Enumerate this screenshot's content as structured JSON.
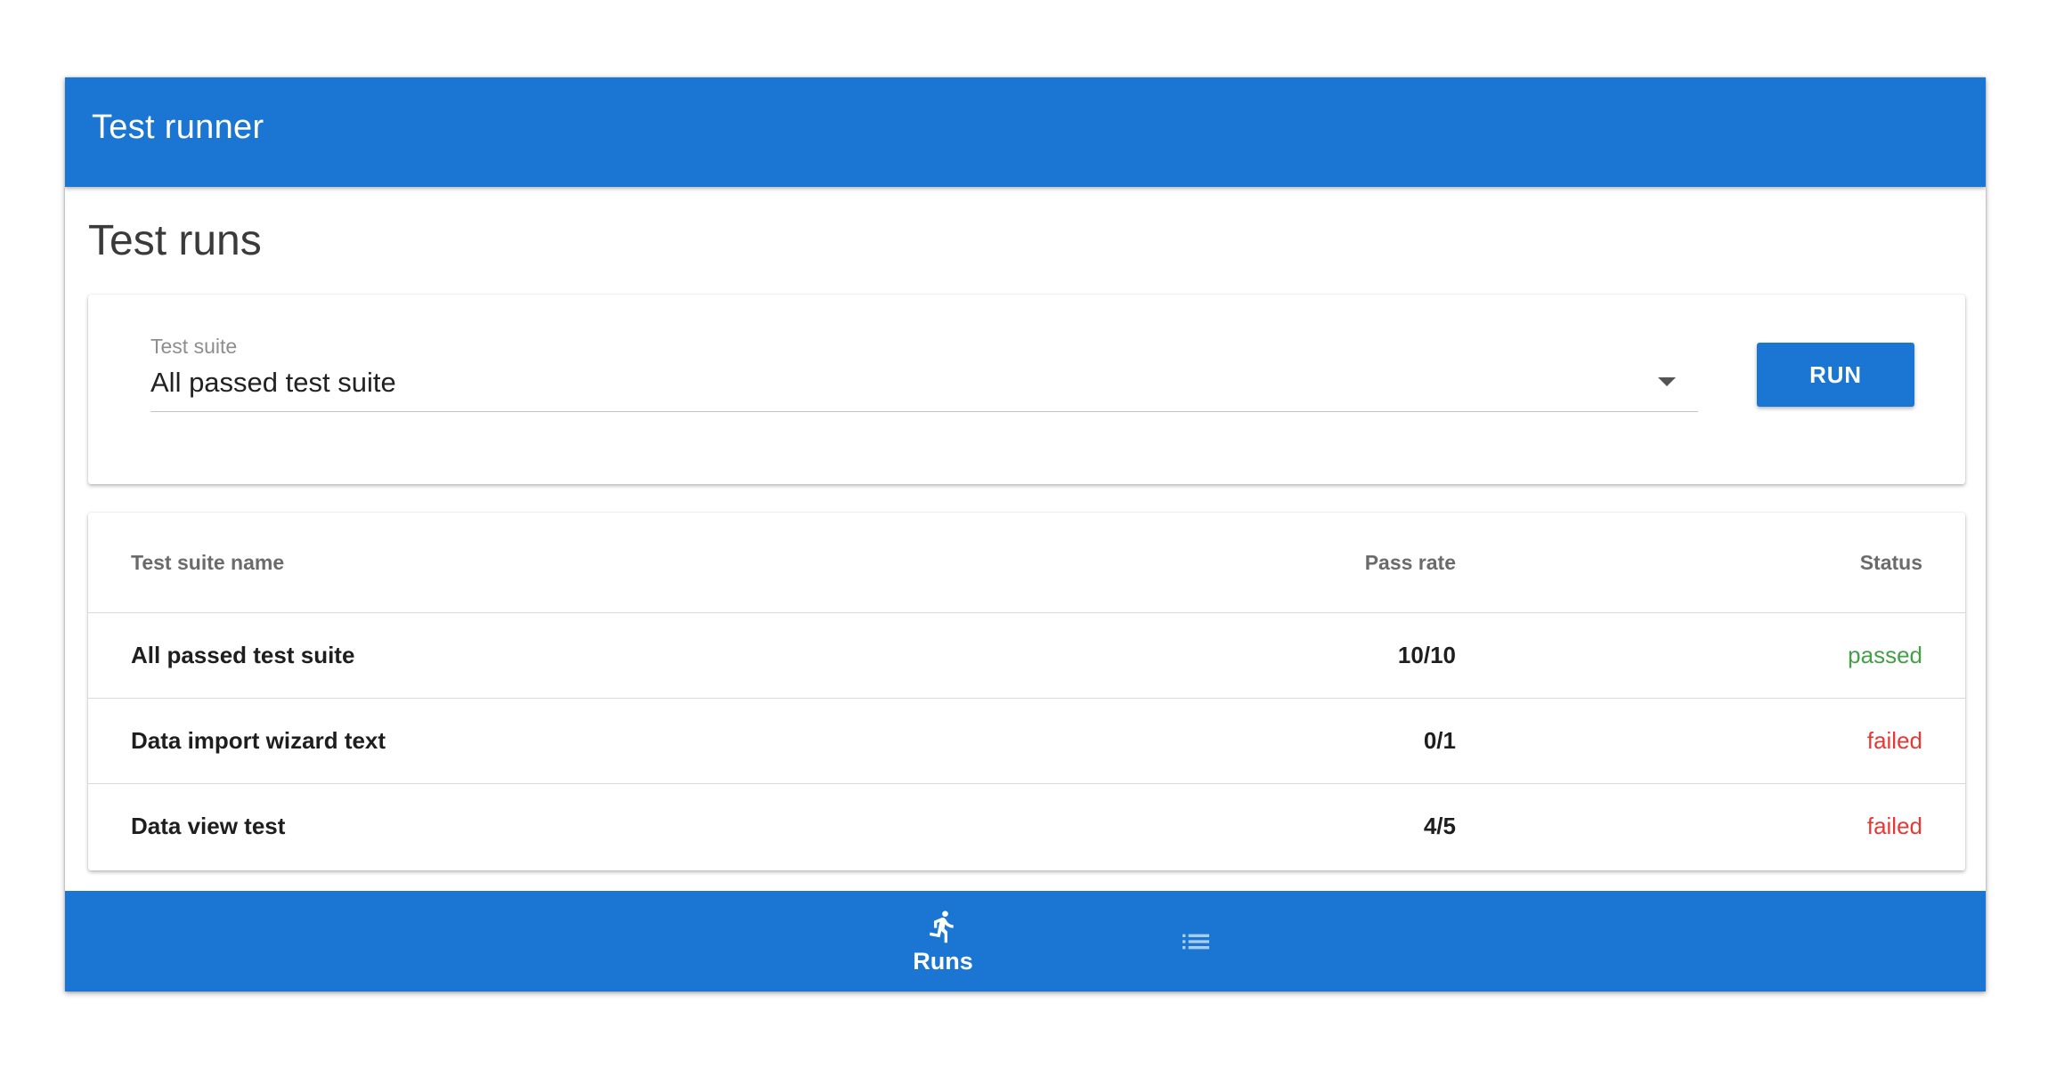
{
  "app": {
    "title": "Test runner",
    "brand_color": "#1a76d2"
  },
  "page": {
    "title": "Test runs"
  },
  "form": {
    "select_label": "Test suite",
    "select_value": "All passed test suite",
    "run_label": "RUN"
  },
  "table": {
    "headers": {
      "name": "Test suite name",
      "pass_rate": "Pass rate",
      "status": "Status"
    },
    "rows": [
      {
        "name": "All passed test suite",
        "pass_rate": "10/10",
        "status": "passed",
        "status_color": "#43a047"
      },
      {
        "name": "Data import wizard text",
        "pass_rate": "0/1",
        "status": "failed",
        "status_color": "#e53935"
      },
      {
        "name": "Data view test",
        "pass_rate": "4/5",
        "status": "failed",
        "status_color": "#e53935"
      }
    ]
  },
  "bottom_nav": {
    "items": [
      {
        "icon": "runner-icon",
        "label": "Runs",
        "active": true
      },
      {
        "icon": "list-icon",
        "label": "",
        "active": false
      }
    ]
  }
}
